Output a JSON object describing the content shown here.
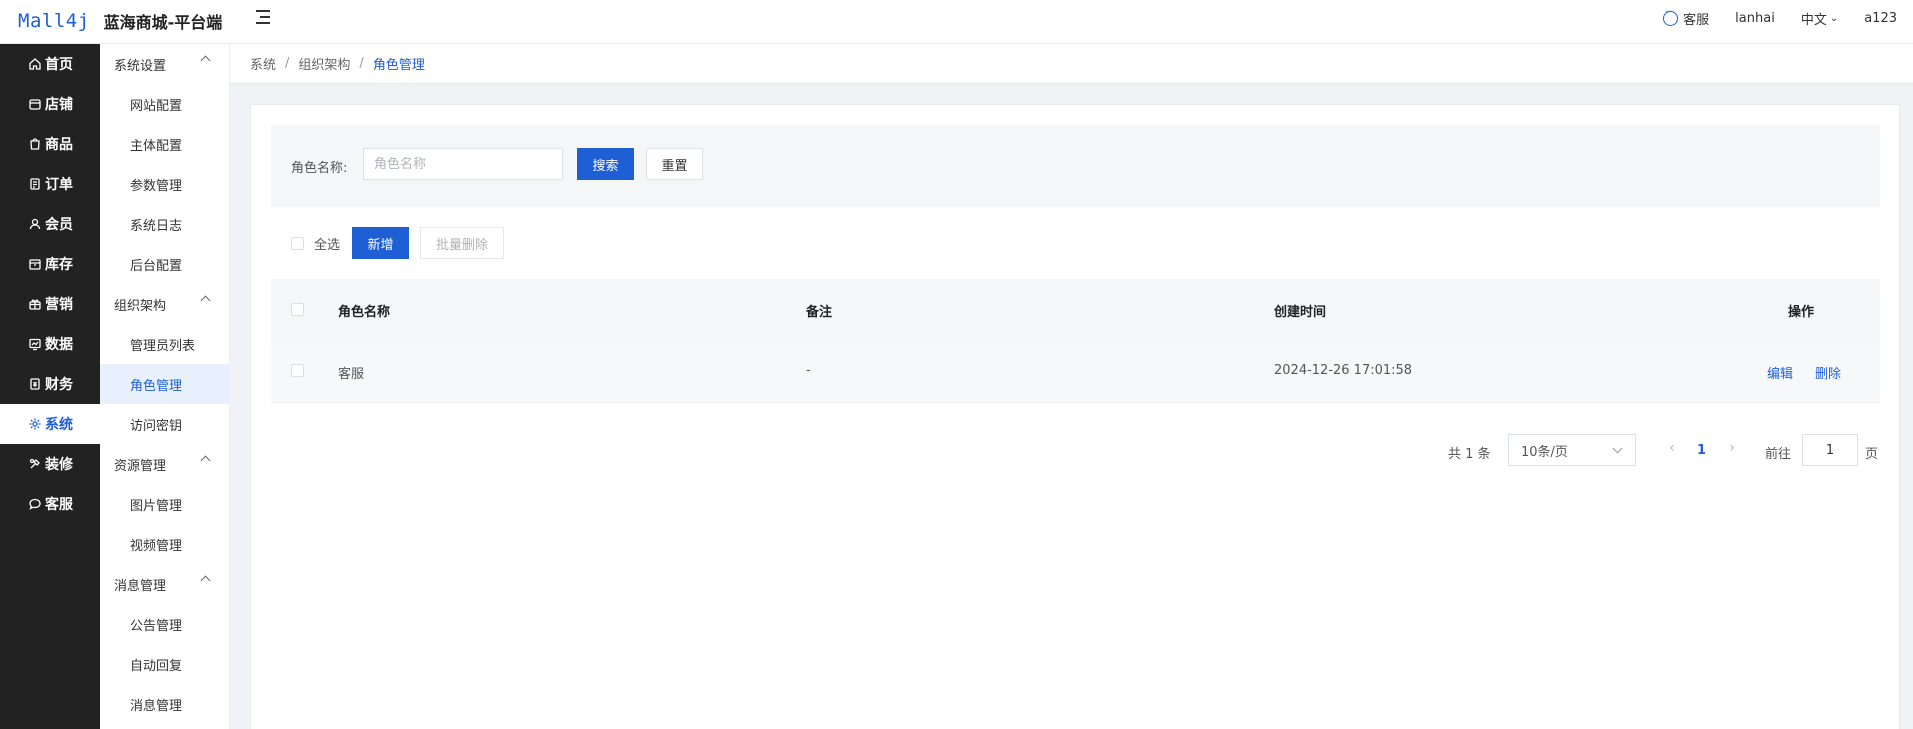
{
  "header": {
    "logo_text": "Mall4j",
    "app_title": "蓝海商城-平台端",
    "service_label": "客服",
    "username": "lanhai",
    "language": "中文",
    "account": "a123"
  },
  "primary_nav": [
    {
      "label": "首页",
      "icon": "home-icon",
      "active": false
    },
    {
      "label": "店铺",
      "icon": "shop-icon",
      "active": false
    },
    {
      "label": "商品",
      "icon": "product-icon",
      "active": false
    },
    {
      "label": "订单",
      "icon": "order-icon",
      "active": false
    },
    {
      "label": "会员",
      "icon": "member-icon",
      "active": false
    },
    {
      "label": "库存",
      "icon": "inventory-icon",
      "active": false
    },
    {
      "label": "营销",
      "icon": "marketing-icon",
      "active": false
    },
    {
      "label": "数据",
      "icon": "data-icon",
      "active": false
    },
    {
      "label": "财务",
      "icon": "finance-icon",
      "active": false
    },
    {
      "label": "系统",
      "icon": "settings-icon",
      "active": true
    },
    {
      "label": "装修",
      "icon": "decoration-icon",
      "active": false
    },
    {
      "label": "客服",
      "icon": "chat-icon",
      "active": false
    }
  ],
  "secondary_nav": {
    "groups": [
      {
        "label": "系统设置",
        "items": [
          "网站配置",
          "主体配置",
          "参数管理",
          "系统日志",
          "后台配置"
        ]
      },
      {
        "label": "组织架构",
        "items": [
          "管理员列表",
          "角色管理",
          "访问密钥"
        ]
      },
      {
        "label": "资源管理",
        "items": [
          "图片管理",
          "视频管理"
        ]
      },
      {
        "label": "消息管理",
        "items": [
          "公告管理",
          "自动回复",
          "消息管理"
        ]
      }
    ],
    "active_item": "角色管理"
  },
  "breadcrumb": [
    "系统",
    "组织架构",
    "角色管理"
  ],
  "search": {
    "label": "角色名称:",
    "placeholder": "角色名称",
    "value": "",
    "search_button": "搜索",
    "reset_button": "重置"
  },
  "toolbar": {
    "select_all": "全选",
    "add_button": "新增",
    "batch_delete_button": "批量删除"
  },
  "table": {
    "columns": [
      "角色名称",
      "备注",
      "创建时间",
      "操作"
    ],
    "rows": [
      {
        "name": "客服",
        "remark": "-",
        "created": "2024-12-26 17:01:58",
        "edit": "编辑",
        "delete": "删除"
      }
    ]
  },
  "pagination": {
    "total_text": "共 1 条",
    "page_size": "10条/页",
    "current_page": "1",
    "goto_label": "前往",
    "goto_value": "1",
    "page_suffix": "页"
  },
  "colors": {
    "accent": "#1f5fd6",
    "sidebar_bg": "#222222",
    "active_bg": "#e8f0fe"
  }
}
